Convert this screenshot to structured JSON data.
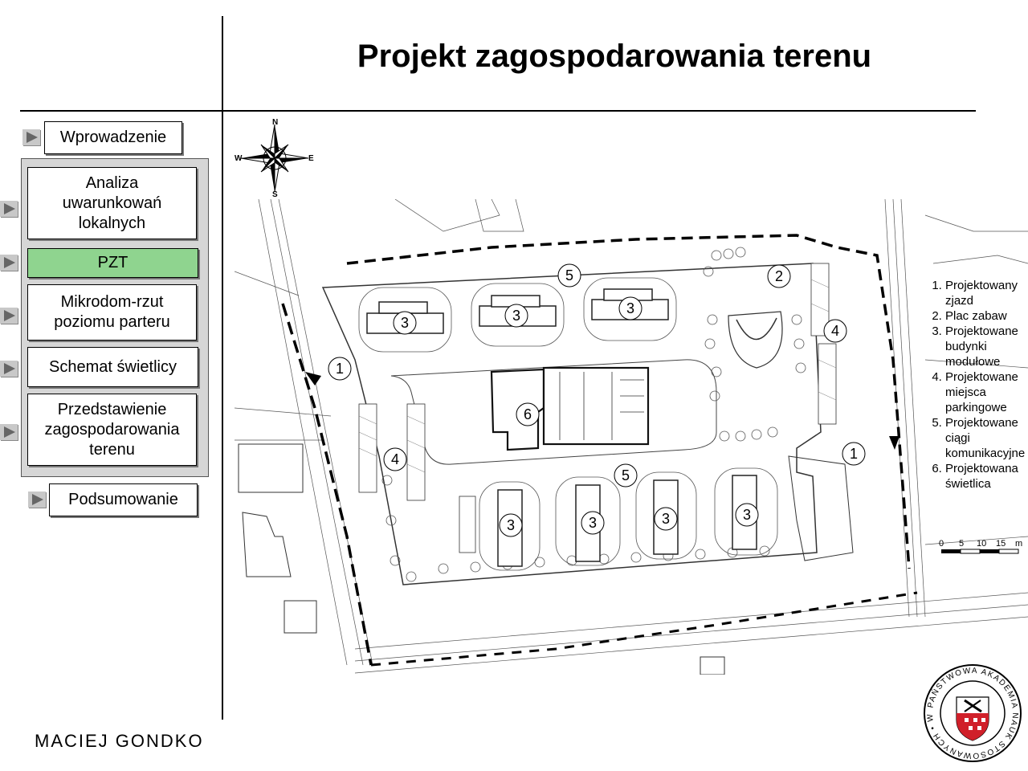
{
  "header": {
    "title": "Projekt zagospodarowania terenu"
  },
  "nav": {
    "intro": "Wprowadzenie",
    "items": [
      "Analiza uwarunkowań lokalnych",
      "PZT",
      "Mikrodom-rzut poziomu parteru",
      "Schemat świetlicy",
      "Przedstawienie zagospodarowania terenu"
    ],
    "active_index": 1,
    "summary": "Podsumowanie",
    "active_color": "#8fd48f"
  },
  "compass": {
    "n": "N",
    "s": "S",
    "e": "E",
    "w": "W"
  },
  "plan_markers": {
    "m1a": "1",
    "m1b": "1",
    "m2": "2",
    "m3a": "3",
    "m3b": "3",
    "m3c": "3",
    "m3d": "3",
    "m3e": "3",
    "m3f": "3",
    "m3g": "3",
    "m4a": "4",
    "m4b": "4",
    "m5a": "5",
    "m5b": "5",
    "m6": "6"
  },
  "legend": {
    "items": [
      "Projektowany zjazd",
      "Plac zabaw",
      "Projektowane budynki modułowe",
      "Projektowane miejsca parkingowe",
      "Projektowane ciągi komunikacyjne",
      "Projektowana świetlica"
    ]
  },
  "scale_bar": {
    "labels": [
      "0",
      "5",
      "10",
      "15",
      "m"
    ]
  },
  "author": "MACIEJ GONDKO",
  "seal": {
    "text": "PAŃSTWOWA AKADEMIA NAUK STOSOWANYCH • W NYSIE •",
    "shield_color": "#d0202a"
  }
}
